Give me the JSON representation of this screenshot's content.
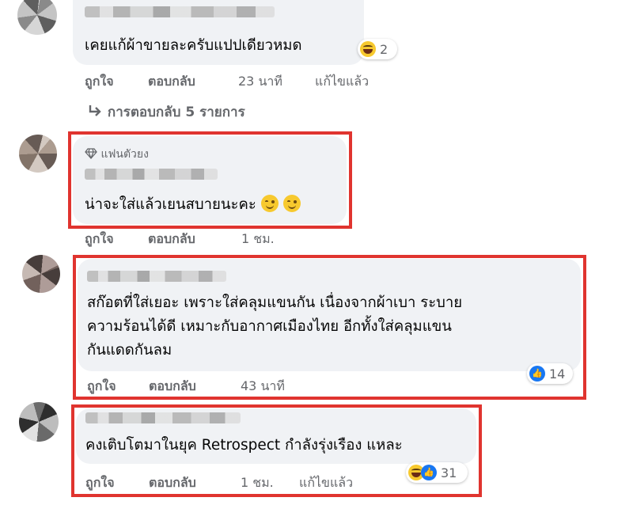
{
  "comments": [
    {
      "text": [
        "เคยแก้ผ้าขายละครับแปปเดียวหมด"
      ],
      "reaction_count": "2",
      "actions": {
        "like": "ถูกใจ",
        "reply": "ตอบกลับ",
        "time": "23 นาที",
        "edited": "แก้ไขแล้ว"
      },
      "replies_link": "การตอบกลับ 5 รายการ"
    },
    {
      "badge": "แฟนตัวยง",
      "text": [
        "น่าจะใส่แล้วเยนสบายนะคะ"
      ],
      "actions": {
        "like": "ถูกใจ",
        "reply": "ตอบกลับ",
        "time": "1 ชม."
      }
    },
    {
      "text": [
        "สก๊อตที่ใส่เยอะ เพราะใส่คลุมแขนกัน เนื่องจากผ้าเบา ระบาย",
        "ความร้อนได้ดี เหมาะกับอากาศเมืองไทย อีกทั้งใส่คลุมแขน",
        "กันแดดกันลม"
      ],
      "reaction_count": "14",
      "actions": {
        "like": "ถูกใจ",
        "reply": "ตอบกลับ",
        "time": "43 นาที"
      }
    },
    {
      "text": [
        "คงเติบโตมาในยุค Retrospect กำลังรุ่งเรือง แหละ"
      ],
      "reaction_count": "31",
      "actions": {
        "like": "ถูกใจ",
        "reply": "ตอบกลับ",
        "time": "1 ชม.",
        "edited": "แก้ไขแล้ว"
      }
    }
  ],
  "colors": {
    "highlight": "#e0342f",
    "bubble": "#f0f2f5",
    "meta": "#65676b",
    "like": "#1877f2"
  },
  "icons": [
    "haha-reaction-icon",
    "like-reaction-icon",
    "smile-emoji-icon",
    "diamond-icon",
    "reply-arrow-icon"
  ]
}
